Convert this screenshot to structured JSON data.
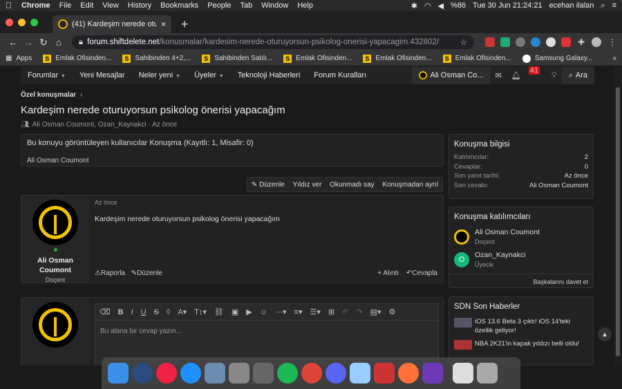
{
  "menubar": {
    "app": "Chrome",
    "items": [
      "File",
      "Edit",
      "View",
      "History",
      "Bookmarks",
      "People",
      "Tab",
      "Window",
      "Help"
    ],
    "battery": "%86",
    "clock": "Tue 30 Jun  21:24:21",
    "user": "ecehan ilalan"
  },
  "tab": {
    "title": "(41) Kardeşim nerede oturuyor",
    "close": "×",
    "new": "+"
  },
  "address": {
    "host": "forum.shiftdelete.net",
    "path": "/konusmalar/kardesim-nerede-oturuyorsun-psikolog-onerisi-yapacagim.432802/"
  },
  "bookmarks": [
    "Emlak Ofisinden...",
    "Sahibinden 4+2,...",
    "Sahibinden Satılı...",
    "Emlak Ofisinden...",
    "Emlak Ofisinden...",
    "Emlak Ofisinden..."
  ],
  "bookmarks_apps": "Apps",
  "bookmarks_last": "Samsung Galaxy...",
  "nav": {
    "items": [
      "Forumlar",
      "Yeni Mesajlar",
      "Neler yeni",
      "Üyeler",
      "Teknoloji Haberleri",
      "Forum Kuralları"
    ],
    "user": "Ali Osman Co...",
    "alerts": "41",
    "search": "Ara"
  },
  "breadcrumb": "Özel konuşmalar",
  "thread": {
    "title": "Kardeşim nerede oturuyorsun psikolog önerisi yapacağım",
    "meta": "Ali Osman Coumont, Ozan_Kaynakci · Az önce"
  },
  "viewers": {
    "head": "Bu konuyu görüntüleyen kullanıcılar Konuşma (Kayıtlı: 1, Misafir: 0)",
    "name": "Ali Osman Coumont"
  },
  "actions": [
    "Düzenle",
    "Yıldız ver",
    "Okunmadı say",
    "Konuşmadan ayrıl"
  ],
  "post": {
    "author_line1": "Ali Osman",
    "author_line2": "Coumont",
    "rank": "Doçent",
    "date": "Az önce",
    "body": "Kardeşim nerede oturuyorsun psikolog önerisi yapacağım",
    "report": "Raporla",
    "edit": "Düzenle",
    "quote": "+ Alıntı",
    "reply": "Cevapla"
  },
  "editor": {
    "placeholder": "Bu alana bir cevap yazın..."
  },
  "info": {
    "title": "Konuşma bilgisi",
    "rows": [
      {
        "k": "Katılımcılar:",
        "v": "2"
      },
      {
        "k": "Cevaplar:",
        "v": "0"
      },
      {
        "k": "Son yanıt tarihi:",
        "v": "Az önce"
      },
      {
        "k": "Son cevabı:",
        "v": "Ali Osman Coumont"
      }
    ]
  },
  "participants": {
    "title": "Konuşma katılımcıları",
    "list": [
      {
        "name": "Ali Osman Coumont",
        "rank": "Doçent"
      },
      {
        "name": "Ozan_Kaynakci",
        "rank": "Üyecik",
        "initial": "O"
      }
    ],
    "invite": "Başkalarını davet et"
  },
  "news": {
    "title": "SDN Son Haberler",
    "items": [
      "iOS 13.6 Beta 3 çıktı! iOS 14'teki özellik geliyor!",
      "NBA 2K21'in kapak yıldızı belli oldu!"
    ]
  },
  "colors": {
    "accent": "#f2c200",
    "green_avatar": "#14b87a"
  }
}
